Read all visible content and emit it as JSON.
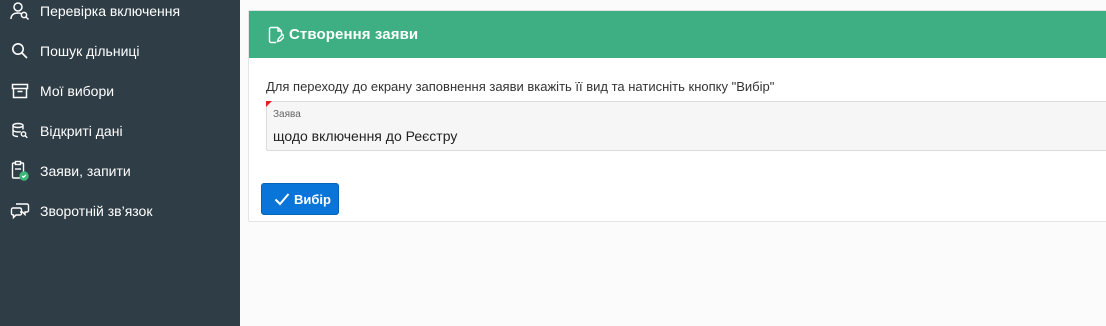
{
  "sidebar": {
    "items": [
      {
        "label": "Перевірка включення",
        "icon": "user-search-icon"
      },
      {
        "label": "Пошук дільниці",
        "icon": "search-icon"
      },
      {
        "label": "Мої вибори",
        "icon": "archive-icon"
      },
      {
        "label": "Відкриті дані",
        "icon": "database-search-icon"
      },
      {
        "label": "Заяви, запити",
        "icon": "clipboard-check-icon"
      },
      {
        "label": "Зворотній зв’язок",
        "icon": "chat-bubbles-icon"
      }
    ]
  },
  "panel": {
    "title": "Створення заяви",
    "title_icon": "document-edit-icon",
    "instruction": "Для переходу до екрану заповнення заяви вкажіть її вид та натисніть кнопку \"Вибір\"",
    "field": {
      "label": "Заява",
      "value": "щодо включення до Реєстру"
    },
    "button": {
      "label": "Вибір",
      "icon": "check-icon"
    }
  },
  "colors": {
    "sidebar_bg": "#2f3d46",
    "header_bg": "#3eaf82",
    "button_bg": "#0a75d8",
    "required_mark": "#e02020",
    "badge_green": "#3cb878"
  }
}
